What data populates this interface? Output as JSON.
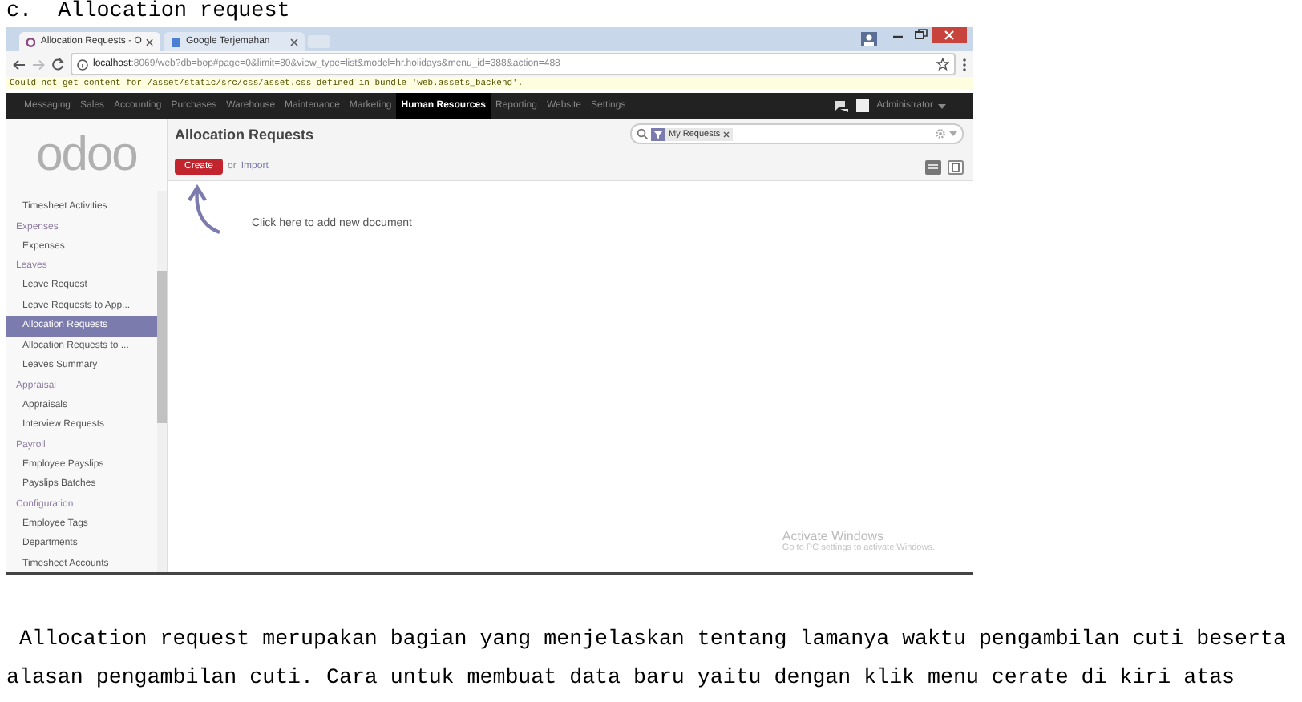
{
  "heading": "c.  Allocation request",
  "browser": {
    "tabs": [
      {
        "title": "Allocation Requests - O",
        "selected": true
      },
      {
        "title": "Google Terjemahan",
        "selected": false
      }
    ],
    "url_host": "localhost",
    "url_path": ":8069/web?db=bop#page=0&limit=80&view_type=list&model=hr.holidays&menu_id=388&action=488"
  },
  "warning": "Could not get content for /asset/static/src/css/asset.css defined in bundle 'web.assets_backend'.",
  "menu": [
    {
      "label": "Messaging",
      "selected": false
    },
    {
      "label": "Sales",
      "selected": false
    },
    {
      "label": "Accounting",
      "selected": false
    },
    {
      "label": "Purchases",
      "selected": false
    },
    {
      "label": "Warehouse",
      "selected": false
    },
    {
      "label": "Maintenance",
      "selected": false
    },
    {
      "label": "Marketing",
      "selected": false
    },
    {
      "label": "Human Resources",
      "selected": true
    },
    {
      "label": "Reporting",
      "selected": false
    },
    {
      "label": "Website",
      "selected": false
    },
    {
      "label": "Settings",
      "selected": false
    }
  ],
  "user": "Administrator",
  "logo": "odoo",
  "sidebar": [
    {
      "kind": "item",
      "label": "Timesheet Activities",
      "selected": false
    },
    {
      "kind": "section",
      "label": "Expenses"
    },
    {
      "kind": "item",
      "label": "Expenses",
      "selected": false
    },
    {
      "kind": "section",
      "label": "Leaves"
    },
    {
      "kind": "item",
      "label": "Leave Request",
      "selected": false
    },
    {
      "kind": "item",
      "label": "Leave Requests to App...",
      "selected": false
    },
    {
      "kind": "item",
      "label": "Allocation Requests",
      "selected": true
    },
    {
      "kind": "item",
      "label": "Allocation Requests to ...",
      "selected": false
    },
    {
      "kind": "item",
      "label": "Leaves Summary",
      "selected": false
    },
    {
      "kind": "section",
      "label": "Appraisal"
    },
    {
      "kind": "item",
      "label": "Appraisals",
      "selected": false
    },
    {
      "kind": "item",
      "label": "Interview Requests",
      "selected": false
    },
    {
      "kind": "section",
      "label": "Payroll"
    },
    {
      "kind": "item",
      "label": "Employee Payslips",
      "selected": false
    },
    {
      "kind": "item",
      "label": "Payslips Batches",
      "selected": false
    },
    {
      "kind": "section",
      "label": "Configuration"
    },
    {
      "kind": "item",
      "label": "Employee Tags",
      "selected": false
    },
    {
      "kind": "item",
      "label": "Departments",
      "selected": false
    },
    {
      "kind": "item",
      "label": "Timesheet Accounts",
      "selected": false
    }
  ],
  "view": {
    "title": "Allocation Requests",
    "create": "Create",
    "or": "or",
    "import": "Import",
    "facet": "My Requests",
    "hint": "Click here to add new document"
  },
  "activation": {
    "title": "Activate Windows",
    "subtitle": "Go to PC settings to activate Windows."
  },
  "paragraph": " Allocation request merupakan bagian yang menjelaskan tentang lamanya waktu pengambilan cuti beserta alasan pengambilan cuti. Cara untuk membuat data baru yaitu dengan klik menu cerate di kiri atas"
}
